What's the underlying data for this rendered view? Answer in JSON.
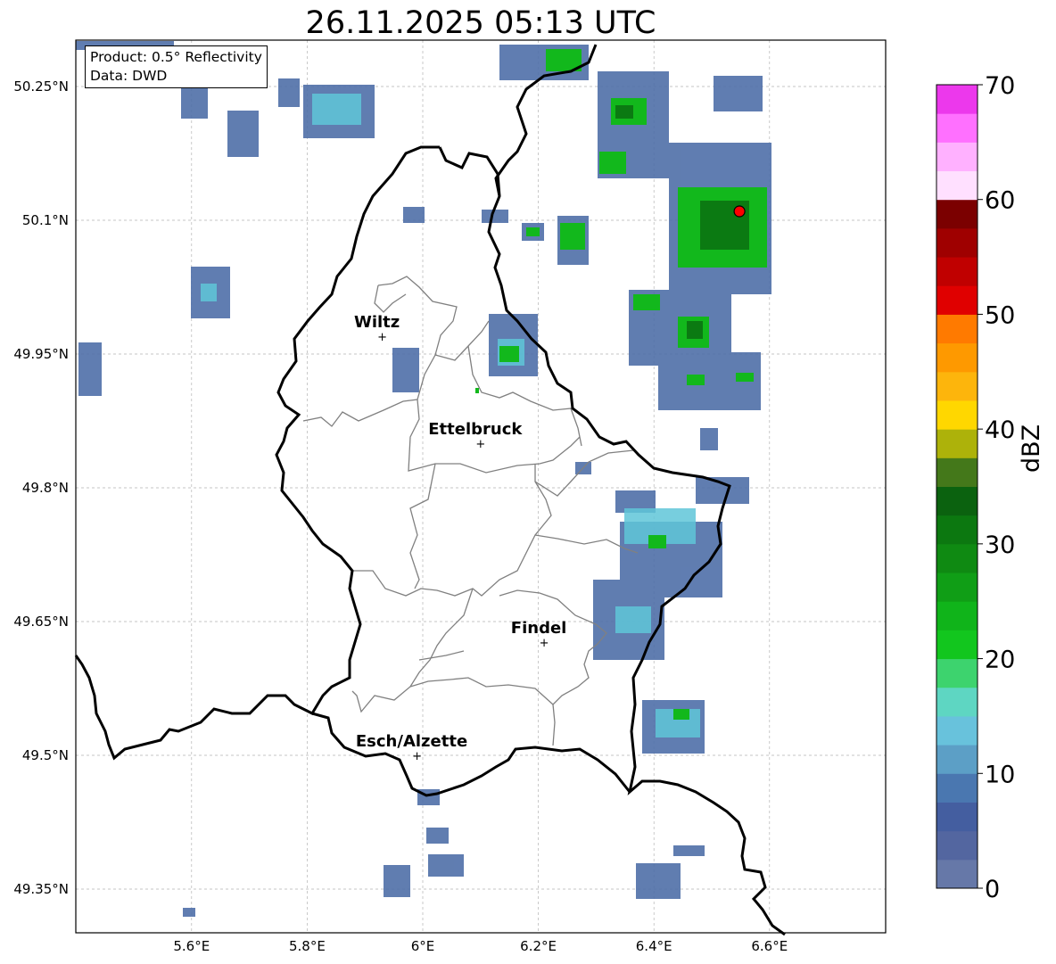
{
  "title": "26.11.2025 05:13 UTC",
  "info": {
    "product": "Product: 0.5° Reflectivity",
    "data": "Data: DWD"
  },
  "axes": {
    "x_ticks": [
      "5.6°E",
      "5.8°E",
      "6°E",
      "6.2°E",
      "6.4°E",
      "6.6°E"
    ],
    "y_ticks": [
      "50.25°N",
      "50.1°N",
      "49.95°N",
      "49.8°N",
      "49.65°N",
      "49.5°N",
      "49.35°N"
    ]
  },
  "cities": [
    {
      "name": "Wiltz",
      "lon": 5.93,
      "lat": 49.97
    },
    {
      "name": "Ettelbruck",
      "lon": 6.1,
      "lat": 49.85
    },
    {
      "name": "Findel",
      "lon": 6.21,
      "lat": 49.627
    },
    {
      "name": "Esch/Alzette",
      "lon": 5.99,
      "lat": 49.5
    }
  ],
  "radar_site": {
    "lon": 6.548,
    "lat": 50.11,
    "color": "#ff0000"
  },
  "colorbar": {
    "label": "dBZ",
    "ticks": [
      "0",
      "10",
      "20",
      "30",
      "40",
      "50",
      "60",
      "70"
    ],
    "colors": [
      "#6678a8",
      "#5366a0",
      "#445ea0",
      "#4a77b0",
      "#5c9fc6",
      "#68c2dc",
      "#5ed6c2",
      "#3dd36e",
      "#12c61e",
      "#10b41a",
      "#109e16",
      "#0f8a12",
      "#0c7810",
      "#0b620f",
      "#44781a",
      "#adb20a",
      "#ffd700",
      "#fdb50c",
      "#fe9900",
      "#ff7a00",
      "#e00000",
      "#c00000",
      "#9f0000",
      "#7b0000",
      "#ffe0ff",
      "#ffb1ff",
      "#ff70ff",
      "#ec38ec"
    ]
  },
  "colors": {
    "border_country": "#000000",
    "border_admin": "#808080",
    "grid": "#b3b3b3"
  }
}
